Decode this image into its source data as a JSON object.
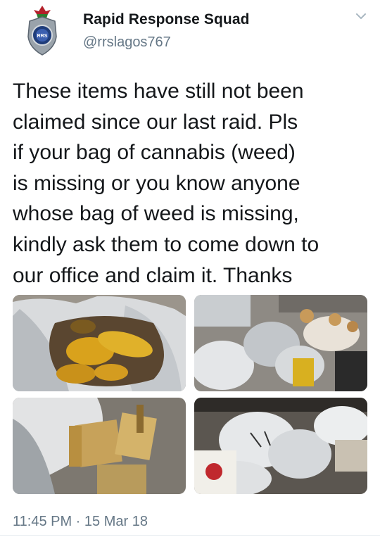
{
  "author": {
    "name": "Rapid Response Squad",
    "handle": "@rrslagos767",
    "avatar_icon": "police-badge-icon",
    "avatar_text": "RRS"
  },
  "menu_icon": "chevron-down-icon",
  "tweet": {
    "text": "These items have still not been\nclaimed since our last raid. Pls\nif your bag of cannabis (weed)\nis missing or you know anyone\nwhose bag of weed is missing,\nkindly ask them to come down to\nour office and claim it. Thanks",
    "timestamp": "11:45 PM · 15 Mar 18"
  },
  "photos": [
    {
      "subject": "open-sack-with-wrapped-packages"
    },
    {
      "subject": "piles-of-sacks-on-ground"
    },
    {
      "subject": "compressed-blocks-in-sack"
    },
    {
      "subject": "marked-sacks-stacked"
    }
  ],
  "colors": {
    "text": "#14171a",
    "secondary": "#657786",
    "divider": "#e6ecf0"
  }
}
